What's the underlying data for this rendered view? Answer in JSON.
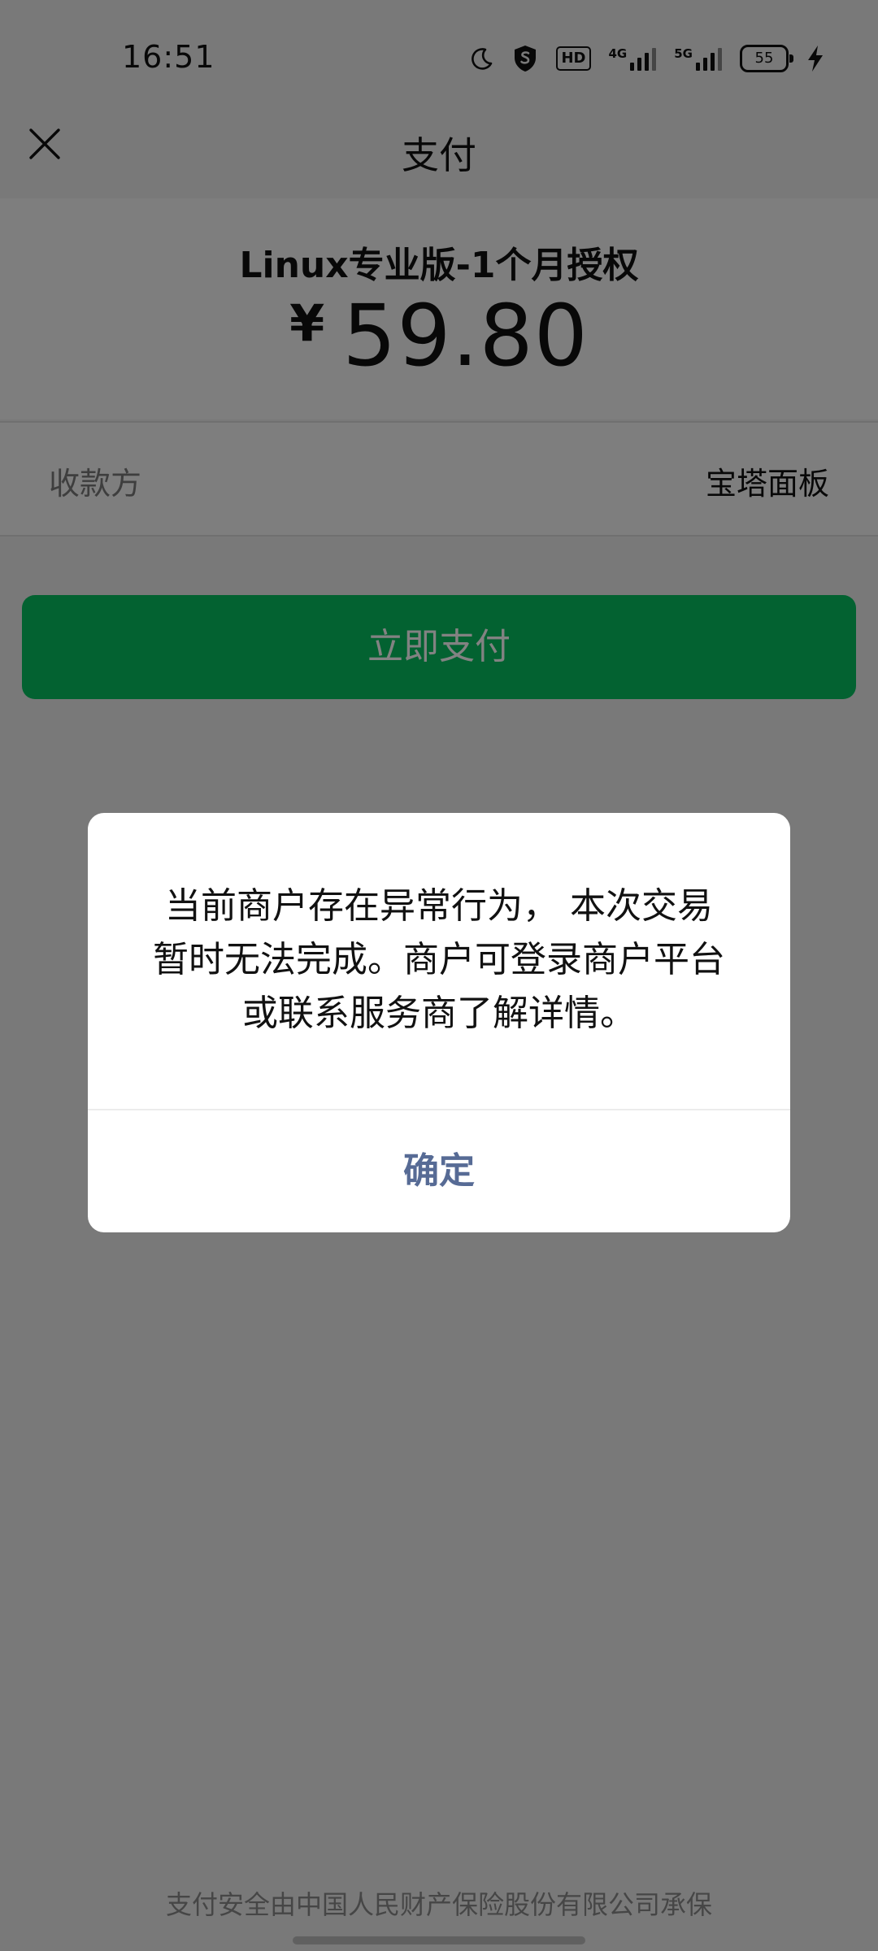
{
  "status_bar": {
    "time": "16:51",
    "hd_label": "HD",
    "network_4g": "4G",
    "network_5g": "5G",
    "battery": "55",
    "icons": [
      "moon-icon",
      "shield-s-icon",
      "hd-icon",
      "signal-4g-icon",
      "signal-5g-icon",
      "battery-icon",
      "charging-bolt-icon"
    ]
  },
  "nav": {
    "title": "支付",
    "close_icon": "close-icon"
  },
  "product": {
    "name": "Linux专业版-1个月授权",
    "currency": "¥",
    "amount": "59.80"
  },
  "payee": {
    "label": "收款方",
    "value": "宝塔面板"
  },
  "pay_button": {
    "label": "立即支付",
    "color": "#07c160"
  },
  "footer": {
    "note": "支付安全由中国人民财产保险股份有限公司承保"
  },
  "dialog": {
    "message": "当前商户存在异常行为， 本次交易暂时无法完成。商户可登录商户平台或联系服务商了解详情。",
    "confirm_label": "确定",
    "confirm_color": "#576b95"
  }
}
